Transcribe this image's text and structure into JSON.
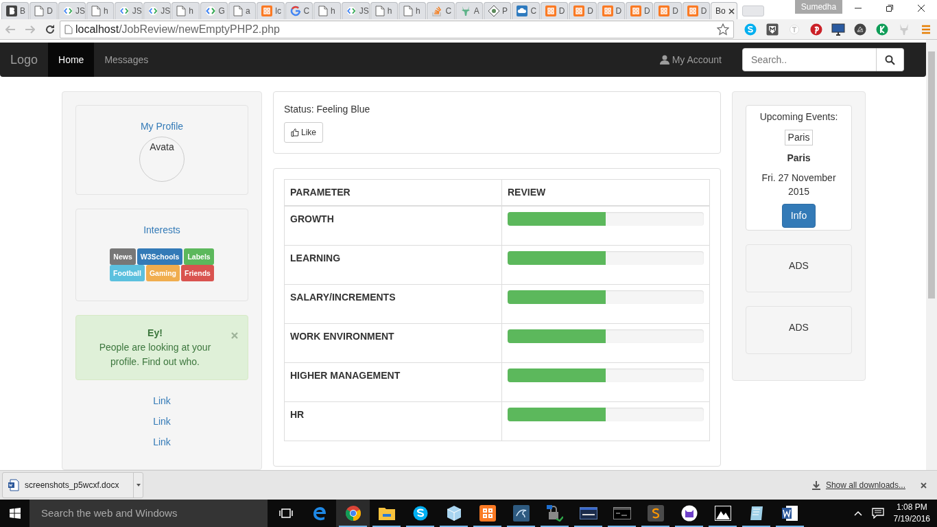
{
  "browser": {
    "tabs": [
      {
        "kind": "bootstrap",
        "label": "B",
        "selected": false
      },
      {
        "kind": "page",
        "label": "D",
        "selected": false
      },
      {
        "kind": "code",
        "label": "JS",
        "selected": false
      },
      {
        "kind": "page",
        "label": "h",
        "selected": false
      },
      {
        "kind": "code",
        "label": "JS",
        "selected": false
      },
      {
        "kind": "code",
        "label": "JS",
        "selected": false
      },
      {
        "kind": "page",
        "label": "h",
        "selected": false
      },
      {
        "kind": "code",
        "label": "G",
        "selected": false
      },
      {
        "kind": "page",
        "label": "a",
        "selected": false
      },
      {
        "kind": "xampp",
        "label": "lc",
        "selected": false
      },
      {
        "kind": "google",
        "label": "C",
        "selected": false
      },
      {
        "kind": "page",
        "label": "h",
        "selected": false
      },
      {
        "kind": "code",
        "label": "JS",
        "selected": false
      },
      {
        "kind": "page",
        "label": "h",
        "selected": false
      },
      {
        "kind": "page",
        "label": "h",
        "selected": false
      },
      {
        "kind": "stack",
        "label": "C",
        "selected": false
      },
      {
        "kind": "deer",
        "label": "A",
        "selected": false
      },
      {
        "kind": "diamond",
        "label": "P",
        "selected": false
      },
      {
        "kind": "cloud",
        "label": "C",
        "selected": false
      },
      {
        "kind": "xampp",
        "label": "D",
        "selected": false
      },
      {
        "kind": "xampp",
        "label": "D",
        "selected": false
      },
      {
        "kind": "xampp",
        "label": "D",
        "selected": false
      },
      {
        "kind": "xampp",
        "label": "D",
        "selected": false
      },
      {
        "kind": "xampp",
        "label": "D",
        "selected": false
      },
      {
        "kind": "xampp",
        "label": "D",
        "selected": false
      },
      {
        "kind": "none",
        "label": "Bo",
        "selected": true
      }
    ],
    "profile": "Sumedha",
    "url_host": "localhost",
    "url_path": "/JobReview/newEmptyPHP2.php"
  },
  "navbar": {
    "brand": "Logo",
    "items": [
      {
        "label": "Home",
        "selected": true
      },
      {
        "label": "Messages",
        "selected": false
      }
    ],
    "account": "My Account",
    "search": {
      "placeholder": "Search.."
    }
  },
  "profile": {
    "title": "My Profile",
    "avatar_alt": "Avata"
  },
  "interests": {
    "title": "Interests",
    "tags": [
      {
        "label": "News",
        "color": "#777777"
      },
      {
        "label": "W3Schools",
        "color": "#337ab7"
      },
      {
        "label": "Labels",
        "color": "#5cb85c"
      },
      {
        "label": "Football",
        "color": "#5bc0de"
      },
      {
        "label": "Gaming",
        "color": "#f0ad4e"
      },
      {
        "label": "Friends",
        "color": "#d9534f"
      }
    ]
  },
  "alert": {
    "title": "Ey!",
    "message": "People are looking at your profile. Find out who."
  },
  "links": [
    "Link",
    "Link",
    "Link"
  ],
  "status": {
    "text": "Status: Feeling Blue",
    "like": "Like"
  },
  "review_table": {
    "columns": [
      "PARAMETER",
      "REVIEW"
    ],
    "rows": [
      {
        "parameter": "GROWTH",
        "level": 0.5
      },
      {
        "parameter": "LEARNING",
        "level": 0.5
      },
      {
        "parameter": "SALARY/INCREMENTS",
        "level": 0.5
      },
      {
        "parameter": "WORK ENVIRONMENT",
        "level": 0.5
      },
      {
        "parameter": "HIGHER MANAGEMENT",
        "level": 0.5
      },
      {
        "parameter": "HR",
        "level": 0.5
      }
    ]
  },
  "events": {
    "title": "Upcoming Events:",
    "image_alt": "Paris",
    "name": "Paris",
    "date": "Fri. 27 November 2015",
    "button": "Info"
  },
  "ads": [
    "ADS",
    "ADS"
  ],
  "downloads": {
    "file": "screenshots_p5wcxf.docx",
    "show_all": "Show all downloads..."
  },
  "taskbar": {
    "search_placeholder": "Search the web and Windows",
    "apps": [
      {
        "kind": "edge",
        "running": false,
        "selected": false
      },
      {
        "kind": "chrome",
        "running": true,
        "selected": true
      },
      {
        "kind": "folder",
        "running": true,
        "selected": false
      },
      {
        "kind": "skype",
        "running": true,
        "selected": false
      },
      {
        "kind": "cube",
        "running": true,
        "selected": false
      },
      {
        "kind": "xampp",
        "running": true,
        "selected": false
      },
      {
        "kind": "dolphin",
        "running": true,
        "selected": false
      },
      {
        "kind": "lock",
        "running": true,
        "selected": false
      },
      {
        "kind": "window",
        "running": true,
        "selected": false
      },
      {
        "kind": "console",
        "running": true,
        "selected": false
      },
      {
        "kind": "sublime",
        "running": true,
        "selected": false
      },
      {
        "kind": "cat",
        "running": true,
        "selected": false
      },
      {
        "kind": "photo",
        "running": true,
        "selected": false
      },
      {
        "kind": "notepad",
        "running": true,
        "selected": false
      },
      {
        "kind": "word",
        "running": true,
        "selected": false
      }
    ],
    "time": "1:08 PM",
    "date": "7/19/2016"
  }
}
